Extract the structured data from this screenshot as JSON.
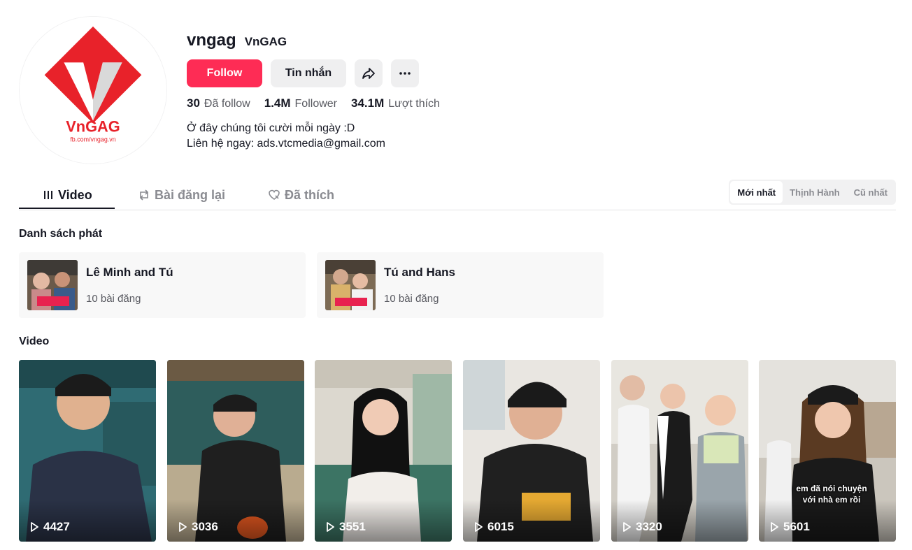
{
  "profile": {
    "username": "vngag",
    "nickname": "VnGAG",
    "avatar_logo_text": "VnGAG",
    "avatar_logo_url": "fb.com/vngag.vn",
    "follow_label": "Follow",
    "message_label": "Tin nhắn",
    "share_icon": "share-icon",
    "more_icon": "more-icon",
    "stats": {
      "following_value": "30",
      "following_label": "Đã follow",
      "followers_value": "1.4M",
      "followers_label": "Follower",
      "likes_value": "34.1M",
      "likes_label": "Lượt thích"
    },
    "bio_line1": "Ở đây chúng tôi cười mỗi ngày :D",
    "bio_line2": "Liên hệ ngay: ads.vtcmedia@gmail.com"
  },
  "tabs": [
    {
      "label": "Video",
      "icon": "grid-icon",
      "active": true
    },
    {
      "label": "Bài đăng lại",
      "icon": "repost-icon",
      "active": false
    },
    {
      "label": "Đã thích",
      "icon": "heart-icon",
      "active": false
    }
  ],
  "sort": [
    {
      "label": "Mới nhất",
      "active": true
    },
    {
      "label": "Thịnh Hành",
      "active": false
    },
    {
      "label": "Cũ nhất",
      "active": false
    }
  ],
  "playlists_title": "Danh sách phát",
  "playlists": [
    {
      "title": "Lê Minh and Tú",
      "count": "10 bài đăng"
    },
    {
      "title": "Tú and Hans",
      "count": "10 bài đăng"
    }
  ],
  "videos_title": "Video",
  "videos": [
    {
      "views": "4427",
      "caption": ""
    },
    {
      "views": "3036",
      "caption": ""
    },
    {
      "views": "3551",
      "caption": ""
    },
    {
      "views": "6015",
      "caption": ""
    },
    {
      "views": "3320",
      "caption": ""
    },
    {
      "views": "5601",
      "caption": "em đã nói chuyện với nhà em rồi"
    }
  ],
  "colors": {
    "accent": "#fe2c55",
    "text_primary": "#161823",
    "text_secondary": "#57585f",
    "logo_red": "#e8222a"
  }
}
